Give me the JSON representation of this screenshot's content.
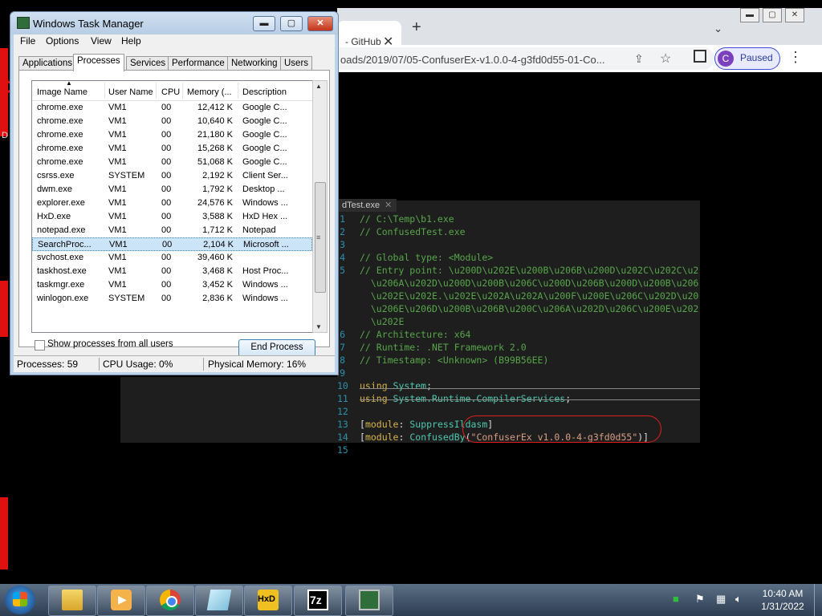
{
  "background": {
    "left_letters": [
      "C",
      "D"
    ]
  },
  "chrome": {
    "tab_title": "- GitHub",
    "tab_close": "✕",
    "new_tab": "+",
    "tab_dropdown": "⌄",
    "url": "oads/2019/07/05-ConfuserEx-v1.0.0-4-g3fd0d55-01-Co...",
    "profile_initial": "C",
    "profile_status": "Paused"
  },
  "editor": {
    "file_tab": "dTest.exe",
    "lines": [
      {
        "n": "1",
        "parts": [
          {
            "c": "cm",
            "t": "// C:\\Temp\\b1.exe"
          }
        ]
      },
      {
        "n": "2",
        "parts": [
          {
            "c": "cm",
            "t": "// ConfusedTest.exe"
          }
        ]
      },
      {
        "n": "3",
        "parts": [
          {
            "c": "cm",
            "t": ""
          }
        ]
      },
      {
        "n": "4",
        "parts": [
          {
            "c": "cm",
            "t": "// Global type: <Module>"
          }
        ]
      },
      {
        "n": "5",
        "parts": [
          {
            "c": "cm",
            "t": "// Entry point: \\u200D\\u202E\\u200B\\u206B\\u200D\\u202C\\u202C\\u2"
          }
        ]
      },
      {
        "n": "",
        "parts": [
          {
            "c": "cm",
            "t": "  \\u206A\\u202D\\u200D\\u200B\\u206C\\u200D\\u206B\\u200D\\u200B\\u206"
          }
        ]
      },
      {
        "n": "",
        "parts": [
          {
            "c": "cm",
            "t": "  \\u202E\\u202E.\\u202E\\u202A\\u202A\\u200F\\u200E\\u206C\\u202D\\u20"
          }
        ]
      },
      {
        "n": "",
        "parts": [
          {
            "c": "cm",
            "t": "  \\u206E\\u206D\\u200B\\u206B\\u200C\\u206A\\u202D\\u206C\\u200E\\u202"
          }
        ]
      },
      {
        "n": "",
        "parts": [
          {
            "c": "cm",
            "t": "  \\u202E"
          }
        ]
      },
      {
        "n": "6",
        "parts": [
          {
            "c": "cm",
            "t": "// Architecture: x64"
          }
        ]
      },
      {
        "n": "7",
        "parts": [
          {
            "c": "cm",
            "t": "// Runtime: .NET Framework 2.0"
          }
        ]
      },
      {
        "n": "8",
        "parts": [
          {
            "c": "cm",
            "t": "// Timestamp: <Unknown> (B99B56EE)"
          }
        ]
      },
      {
        "n": "9",
        "parts": [
          {
            "c": "pl",
            "t": ""
          }
        ]
      },
      {
        "n": "10",
        "parts": [
          {
            "c": "kw",
            "t": "using "
          },
          {
            "c": "ty",
            "t": "System"
          },
          {
            "c": "pl",
            "t": ";"
          }
        ]
      },
      {
        "n": "11",
        "parts": [
          {
            "c": "kw",
            "t": "using "
          },
          {
            "c": "ty",
            "t": "System.Runtime.CompilerServices"
          },
          {
            "c": "pl",
            "t": ";"
          }
        ]
      },
      {
        "n": "12",
        "parts": [
          {
            "c": "pl",
            "t": ""
          }
        ]
      },
      {
        "n": "13",
        "parts": [
          {
            "c": "pl",
            "t": "["
          },
          {
            "c": "kw",
            "t": "module"
          },
          {
            "c": "pl",
            "t": ": "
          },
          {
            "c": "ty",
            "t": "SuppressIldasm"
          },
          {
            "c": "pl",
            "t": "]"
          }
        ]
      },
      {
        "n": "14",
        "parts": [
          {
            "c": "pl",
            "t": "["
          },
          {
            "c": "kw",
            "t": "module"
          },
          {
            "c": "pl",
            "t": ": "
          },
          {
            "c": "ty",
            "t": "ConfusedBy"
          },
          {
            "c": "pl",
            "t": "("
          },
          {
            "c": "st",
            "t": "\"ConfuserEx v1.0.0-4-g3fd0d55\""
          },
          {
            "c": "pl",
            "t": ")]"
          }
        ]
      },
      {
        "n": "15",
        "parts": [
          {
            "c": "pl",
            "t": ""
          }
        ]
      }
    ]
  },
  "taskmgr": {
    "title": "Windows Task Manager",
    "controls": {
      "minimize": "▬",
      "maximize": "▢",
      "close": "✕"
    },
    "menu": [
      "File",
      "Options",
      "View",
      "Help"
    ],
    "tabs": [
      "Applications",
      "Processes",
      "Services",
      "Performance",
      "Networking",
      "Users"
    ],
    "active_tab": "Processes",
    "columns": [
      "Image Name",
      "User Name",
      "CPU",
      "Memory (...",
      "Description"
    ],
    "rows": [
      [
        "chrome.exe",
        "VM1",
        "00",
        "12,412 K",
        "Google C..."
      ],
      [
        "chrome.exe",
        "VM1",
        "00",
        "10,640 K",
        "Google C..."
      ],
      [
        "chrome.exe",
        "VM1",
        "00",
        "21,180 K",
        "Google C..."
      ],
      [
        "chrome.exe",
        "VM1",
        "00",
        "15,268 K",
        "Google C..."
      ],
      [
        "chrome.exe",
        "VM1",
        "00",
        "51,068 K",
        "Google C..."
      ],
      [
        "csrss.exe",
        "SYSTEM",
        "00",
        "2,192 K",
        "Client Ser..."
      ],
      [
        "dwm.exe",
        "VM1",
        "00",
        "1,792 K",
        "Desktop ..."
      ],
      [
        "explorer.exe",
        "VM1",
        "00",
        "24,576 K",
        "Windows ..."
      ],
      [
        "HxD.exe",
        "VM1",
        "00",
        "3,588 K",
        "HxD Hex ..."
      ],
      [
        "notepad.exe",
        "VM1",
        "00",
        "1,712 K",
        "Notepad"
      ],
      [
        "SearchProc...",
        "VM1",
        "00",
        "2,104 K",
        "Microsoft ..."
      ],
      [
        "svchost.exe",
        "VM1",
        "00",
        "39,460 K",
        ""
      ],
      [
        "taskhost.exe",
        "VM1",
        "00",
        "3,468 K",
        "Host Proc..."
      ],
      [
        "taskmgr.exe",
        "VM1",
        "00",
        "3,452 K",
        "Windows ..."
      ],
      [
        "winlogon.exe",
        "SYSTEM",
        "00",
        "2,836 K",
        "Windows ..."
      ]
    ],
    "selected_row": 10,
    "show_all_label": "Show processes from all users",
    "end_process_label": "End Process",
    "status": {
      "processes": "Processes: 59",
      "cpu": "CPU Usage: 0%",
      "memory": "Physical Memory: 16%"
    }
  },
  "taskbar": {
    "apps": [
      {
        "name": "file-explorer-icon",
        "color": "#e8c24a"
      },
      {
        "name": "media-player-icon",
        "color": "#f0a030"
      },
      {
        "name": "chrome-icon",
        "color": "#db4437"
      },
      {
        "name": "notepad-icon",
        "color": "#9fd3e8"
      },
      {
        "name": "hxd-icon",
        "color": "#f0c020"
      },
      {
        "name": "7zip-icon",
        "color": "#000000"
      },
      {
        "name": "task-manager-icon",
        "color": "#2f6e3a"
      }
    ],
    "sevenzip_label": "7z",
    "hxd_label": "HxD",
    "clock_time": "10:40 AM",
    "clock_date": "1/31/2022"
  }
}
